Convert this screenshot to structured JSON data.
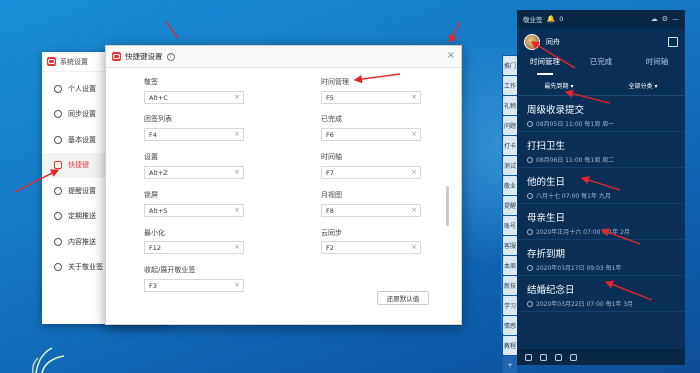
{
  "settings_window": {
    "title": "系统设置",
    "nav": [
      {
        "label": "个人设置",
        "icon": "user-icon"
      },
      {
        "label": "同步设置",
        "icon": "sync-icon"
      },
      {
        "label": "基本设置",
        "icon": "gear-icon"
      },
      {
        "label": "快捷键",
        "icon": "keyboard-icon",
        "active": true
      },
      {
        "label": "提醒设置",
        "icon": "bell-icon"
      },
      {
        "label": "定期推送",
        "icon": "calendar-icon"
      },
      {
        "label": "内容推送",
        "icon": "push-icon"
      },
      {
        "label": "关于敬业签",
        "icon": "info-icon"
      }
    ]
  },
  "shortcut_dialog": {
    "title": "快捷键设置",
    "help_icon_text": "?",
    "close_text": "×",
    "reset_label": "还原默认值",
    "fields_left": [
      {
        "label": "敬签",
        "value": "Alt+C"
      },
      {
        "label": "团签列表",
        "value": "F4"
      },
      {
        "label": "设置",
        "value": "Alt+Z"
      },
      {
        "label": "锁屏",
        "value": "Alt+S"
      },
      {
        "label": "最小化",
        "value": "F12"
      },
      {
        "label": "收起/展开敬业签",
        "value": "F3"
      }
    ],
    "fields_right": [
      {
        "label": "时间管理",
        "value": "F5"
      },
      {
        "label": "已完成",
        "value": "F6"
      },
      {
        "label": "时间轴",
        "value": "F7"
      },
      {
        "label": "月视图",
        "value": "F8"
      },
      {
        "label": "云同步",
        "value": "F2"
      }
    ],
    "clear_glyph": "×"
  },
  "side_strip": [
    "推门",
    "工作",
    "礼物",
    "问题",
    "打卡",
    "测试",
    "敬业",
    "提醒",
    "账号",
    "客服",
    "本周",
    "新技",
    "学习",
    "情感",
    "教程",
    "+"
  ],
  "panel": {
    "app_name": "敬业签",
    "bell_count": "0",
    "username": "同舟",
    "tabs": [
      "时间管理",
      "已完成",
      "时间轴"
    ],
    "active_tab": 0,
    "filters": [
      "最先到期",
      "全部分类"
    ],
    "items": [
      {
        "title": "周级收录提交",
        "sub": "08月05日 11:00 每1周 周一"
      },
      {
        "title": "打扫卫生",
        "sub": "08月06日 11:00 每1周 周二"
      },
      {
        "title": "他的生日",
        "sub": "八月十七 07:00 每1年 九月"
      },
      {
        "title": "母亲生日",
        "sub": "2020年正月十六 07:00 每1年 2月"
      },
      {
        "title": "存折到期",
        "sub": "2020年03月17日 09:03 每1年"
      },
      {
        "title": "结婚纪念日",
        "sub": "2020年03月22日 07:00 每1年 3月"
      }
    ]
  }
}
